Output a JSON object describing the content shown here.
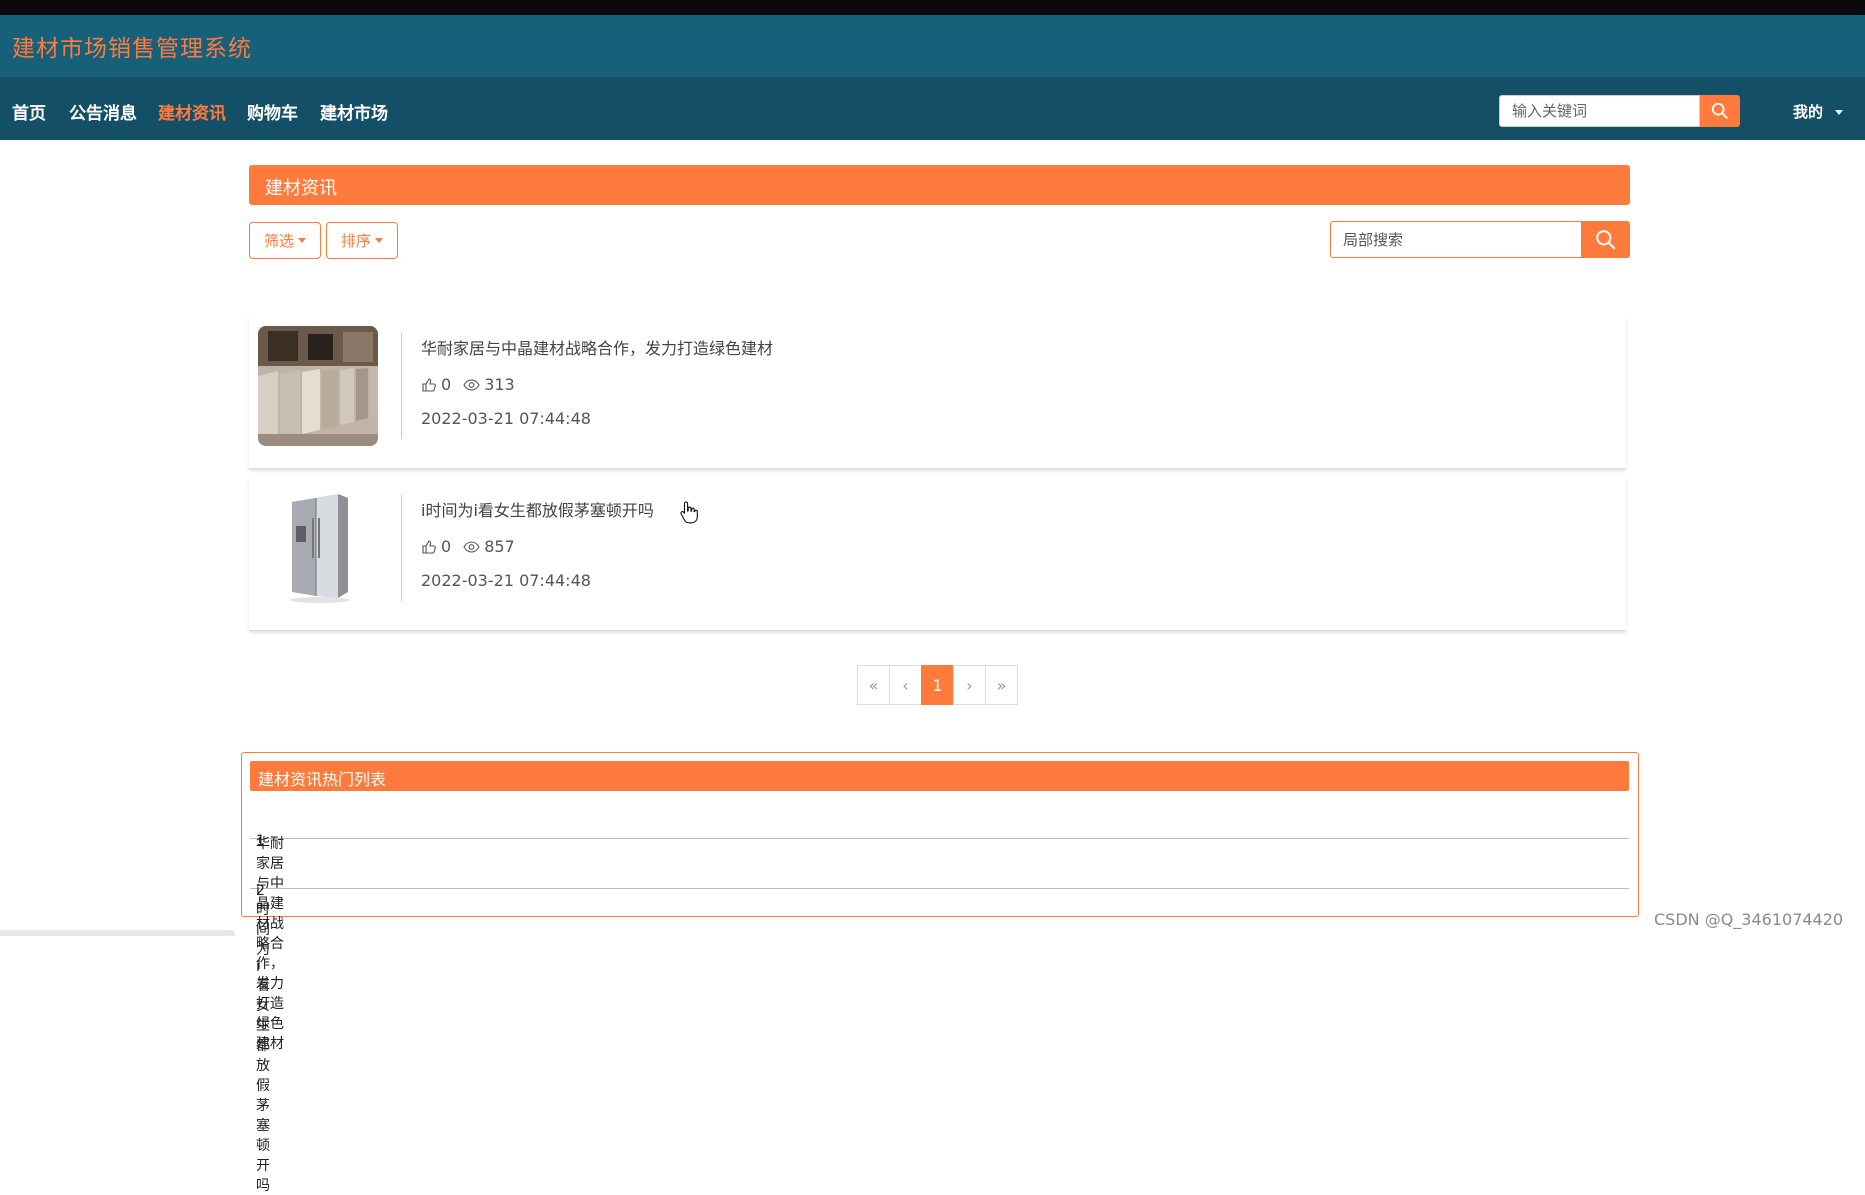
{
  "app": {
    "title": "建材市场销售管理系统"
  },
  "nav": {
    "items": [
      {
        "label": "首页"
      },
      {
        "label": "公告消息"
      },
      {
        "label": "建材资讯"
      },
      {
        "label": "购物车"
      },
      {
        "label": "建材市场"
      }
    ],
    "active": "建材资讯",
    "search_placeholder": "输入关键词",
    "search_icon": "search-icon",
    "user_menu": "我的"
  },
  "section": {
    "title": "建材资讯",
    "filter_label": "筛选",
    "sort_label": "排序",
    "local_search_placeholder": "局部搜索"
  },
  "articles": [
    {
      "title": "华耐家居与中晶建材战略合作，发力打造绿色建材",
      "likes": "0",
      "views": "313",
      "date": "2022-03-21 07:44:48"
    },
    {
      "title": "i时间为i看女生都放假茅塞顿开吗",
      "likes": "0",
      "views": "857",
      "date": "2022-03-21 07:44:48"
    }
  ],
  "pagination": {
    "first": "«",
    "prev": "‹",
    "current": "1",
    "next": "›",
    "last": "»"
  },
  "hot_list": {
    "title": "建材资讯热门列表",
    "items": [
      {
        "rank": "1",
        "title": "华耐家居与中晶建材战略合作，发力打造绿色建材"
      },
      {
        "rank": "2",
        "title": "i时间为i看女生都放假茅塞顿开吗"
      }
    ]
  },
  "watermark": "CSDN @Q_3461074420",
  "colors": {
    "accent": "#ff7a3d",
    "brand_bar": "#16607a",
    "nav_bar": "#134f66"
  }
}
